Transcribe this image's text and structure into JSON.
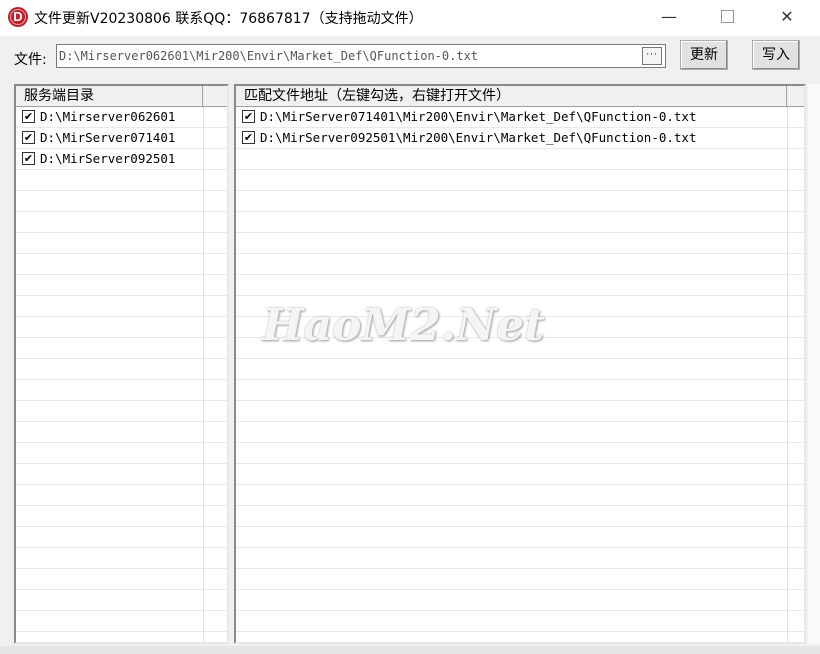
{
  "window": {
    "title": "文件更新V20230806 联系QQ：76867817（支持拖动文件）",
    "icon": "app-logo-icon",
    "minimize_glyph": "—",
    "maximize_glyph": "",
    "close_glyph": "✕"
  },
  "toolbar": {
    "file_label": "文件:",
    "file_value": "D:\\Mirserver062601\\Mir200\\Envir\\Market_Def\\QFunction-0.txt",
    "browse_glyph": "···",
    "update_label": "更新",
    "write_label": "写入"
  },
  "left_panel": {
    "header": "服务端目录",
    "items": [
      {
        "label": "D:\\Mirserver062601",
        "checked": true
      },
      {
        "label": "D:\\MirServer071401",
        "checked": true
      },
      {
        "label": "D:\\MirServer092501",
        "checked": true
      }
    ]
  },
  "right_panel": {
    "header": "匹配文件地址（左键勾选，右键打开文件）",
    "items": [
      {
        "label": "D:\\MirServer071401\\Mir200\\Envir\\Market_Def\\QFunction-0.txt",
        "checked": true
      },
      {
        "label": "D:\\MirServer092501\\Mir200\\Envir\\Market_Def\\QFunction-0.txt",
        "checked": true
      }
    ]
  },
  "watermark": "HaoM2.Net",
  "check_glyph": "✔",
  "colors": {
    "accent_icon": "#c0202a",
    "window_bg": "#f0f0f0",
    "list_bg": "#ffffff"
  }
}
